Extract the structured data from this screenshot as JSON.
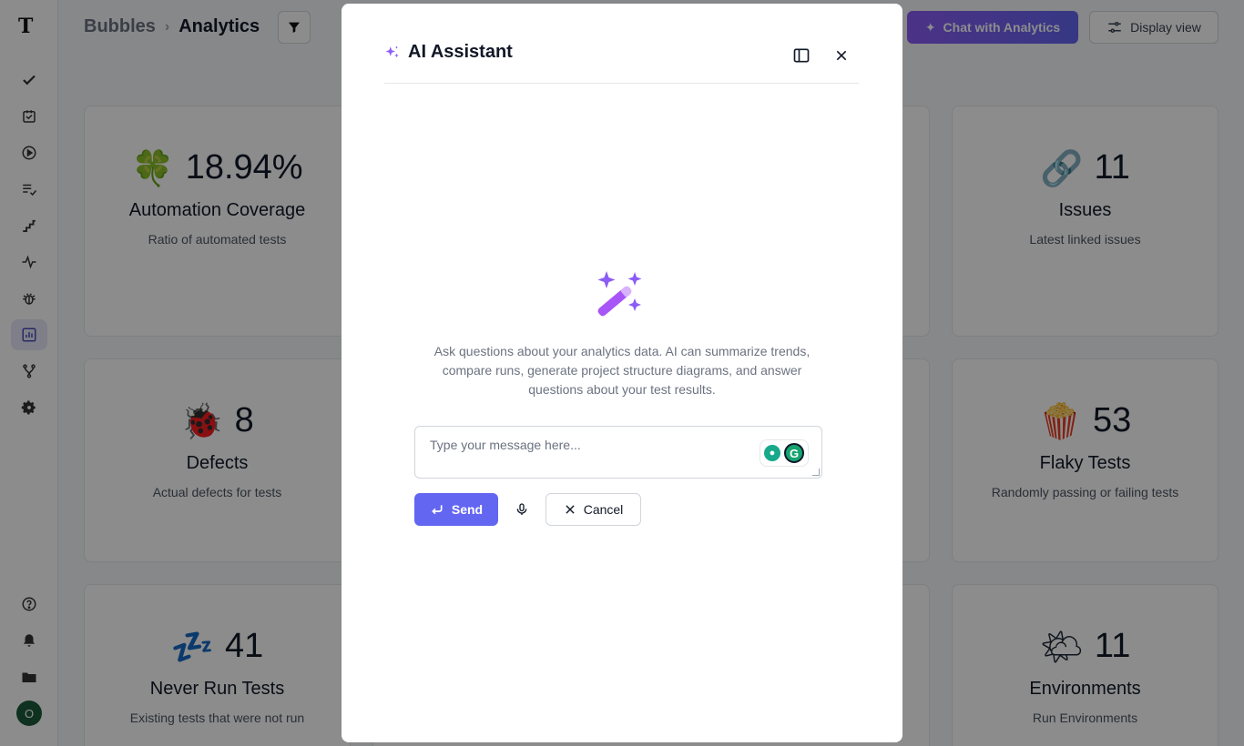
{
  "header": {
    "breadcrumb_project": "Bubbles",
    "breadcrumb_separator": "›",
    "breadcrumb_current": "Analytics",
    "chat_button_label": "Chat with Analytics",
    "display_view_label": "Display view"
  },
  "sidebar": {
    "logo_text": "T",
    "avatar_initial": "O",
    "icons": [
      "check-icon",
      "checklist-icon",
      "play-icon",
      "list-check-icon",
      "steps-icon",
      "pulse-icon",
      "bug-icon",
      "analytics-icon",
      "branch-icon",
      "settings-icon",
      "help-icon",
      "bell-icon",
      "folder-icon"
    ]
  },
  "cards": [
    {
      "emoji": "🍀",
      "value": "18.94%",
      "title": "Automation Coverage",
      "desc": "Ratio of automated tests"
    },
    {
      "emoji": "🔗",
      "value": "11",
      "title": "Issues",
      "desc": "Latest linked issues"
    },
    {
      "emoji": "🐞",
      "value": "8",
      "title": "Defects",
      "desc": "Actual defects for tests"
    },
    {
      "emoji": "🍿",
      "value": "53",
      "title": "Flaky Tests",
      "desc": "Randomly passing or failing tests"
    },
    {
      "emoji": "💤",
      "value": "41",
      "title": "Never Run Tests",
      "desc": "Existing tests that were not run"
    },
    {
      "emoji": "🌤",
      "value": "11",
      "title": "Environments",
      "desc": "Run Environments"
    }
  ],
  "modal": {
    "title": "AI Assistant",
    "description": "Ask questions about your analytics data. AI can summarize trends, compare runs, generate project structure diagrams, and answer questions about your test results.",
    "input_placeholder": "Type your message here...",
    "send_label": "Send",
    "cancel_label": "Cancel",
    "grammarly_letter": "G"
  },
  "colors": {
    "accent": "#6366f1",
    "sparkle": "#8b5cf6",
    "overlay": "rgba(0,0,0,0.45)"
  }
}
